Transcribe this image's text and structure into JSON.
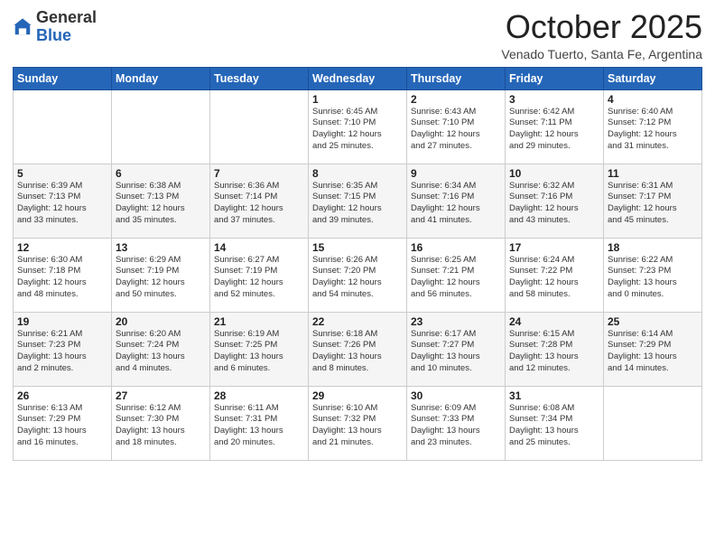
{
  "header": {
    "logo_general": "General",
    "logo_blue": "Blue",
    "month_title": "October 2025",
    "location": "Venado Tuerto, Santa Fe, Argentina"
  },
  "weekdays": [
    "Sunday",
    "Monday",
    "Tuesday",
    "Wednesday",
    "Thursday",
    "Friday",
    "Saturday"
  ],
  "weeks": [
    [
      {
        "day": "",
        "info": ""
      },
      {
        "day": "",
        "info": ""
      },
      {
        "day": "",
        "info": ""
      },
      {
        "day": "1",
        "info": "Sunrise: 6:45 AM\nSunset: 7:10 PM\nDaylight: 12 hours\nand 25 minutes."
      },
      {
        "day": "2",
        "info": "Sunrise: 6:43 AM\nSunset: 7:10 PM\nDaylight: 12 hours\nand 27 minutes."
      },
      {
        "day": "3",
        "info": "Sunrise: 6:42 AM\nSunset: 7:11 PM\nDaylight: 12 hours\nand 29 minutes."
      },
      {
        "day": "4",
        "info": "Sunrise: 6:40 AM\nSunset: 7:12 PM\nDaylight: 12 hours\nand 31 minutes."
      }
    ],
    [
      {
        "day": "5",
        "info": "Sunrise: 6:39 AM\nSunset: 7:13 PM\nDaylight: 12 hours\nand 33 minutes."
      },
      {
        "day": "6",
        "info": "Sunrise: 6:38 AM\nSunset: 7:13 PM\nDaylight: 12 hours\nand 35 minutes."
      },
      {
        "day": "7",
        "info": "Sunrise: 6:36 AM\nSunset: 7:14 PM\nDaylight: 12 hours\nand 37 minutes."
      },
      {
        "day": "8",
        "info": "Sunrise: 6:35 AM\nSunset: 7:15 PM\nDaylight: 12 hours\nand 39 minutes."
      },
      {
        "day": "9",
        "info": "Sunrise: 6:34 AM\nSunset: 7:16 PM\nDaylight: 12 hours\nand 41 minutes."
      },
      {
        "day": "10",
        "info": "Sunrise: 6:32 AM\nSunset: 7:16 PM\nDaylight: 12 hours\nand 43 minutes."
      },
      {
        "day": "11",
        "info": "Sunrise: 6:31 AM\nSunset: 7:17 PM\nDaylight: 12 hours\nand 45 minutes."
      }
    ],
    [
      {
        "day": "12",
        "info": "Sunrise: 6:30 AM\nSunset: 7:18 PM\nDaylight: 12 hours\nand 48 minutes."
      },
      {
        "day": "13",
        "info": "Sunrise: 6:29 AM\nSunset: 7:19 PM\nDaylight: 12 hours\nand 50 minutes."
      },
      {
        "day": "14",
        "info": "Sunrise: 6:27 AM\nSunset: 7:19 PM\nDaylight: 12 hours\nand 52 minutes."
      },
      {
        "day": "15",
        "info": "Sunrise: 6:26 AM\nSunset: 7:20 PM\nDaylight: 12 hours\nand 54 minutes."
      },
      {
        "day": "16",
        "info": "Sunrise: 6:25 AM\nSunset: 7:21 PM\nDaylight: 12 hours\nand 56 minutes."
      },
      {
        "day": "17",
        "info": "Sunrise: 6:24 AM\nSunset: 7:22 PM\nDaylight: 12 hours\nand 58 minutes."
      },
      {
        "day": "18",
        "info": "Sunrise: 6:22 AM\nSunset: 7:23 PM\nDaylight: 13 hours\nand 0 minutes."
      }
    ],
    [
      {
        "day": "19",
        "info": "Sunrise: 6:21 AM\nSunset: 7:23 PM\nDaylight: 13 hours\nand 2 minutes."
      },
      {
        "day": "20",
        "info": "Sunrise: 6:20 AM\nSunset: 7:24 PM\nDaylight: 13 hours\nand 4 minutes."
      },
      {
        "day": "21",
        "info": "Sunrise: 6:19 AM\nSunset: 7:25 PM\nDaylight: 13 hours\nand 6 minutes."
      },
      {
        "day": "22",
        "info": "Sunrise: 6:18 AM\nSunset: 7:26 PM\nDaylight: 13 hours\nand 8 minutes."
      },
      {
        "day": "23",
        "info": "Sunrise: 6:17 AM\nSunset: 7:27 PM\nDaylight: 13 hours\nand 10 minutes."
      },
      {
        "day": "24",
        "info": "Sunrise: 6:15 AM\nSunset: 7:28 PM\nDaylight: 13 hours\nand 12 minutes."
      },
      {
        "day": "25",
        "info": "Sunrise: 6:14 AM\nSunset: 7:29 PM\nDaylight: 13 hours\nand 14 minutes."
      }
    ],
    [
      {
        "day": "26",
        "info": "Sunrise: 6:13 AM\nSunset: 7:29 PM\nDaylight: 13 hours\nand 16 minutes."
      },
      {
        "day": "27",
        "info": "Sunrise: 6:12 AM\nSunset: 7:30 PM\nDaylight: 13 hours\nand 18 minutes."
      },
      {
        "day": "28",
        "info": "Sunrise: 6:11 AM\nSunset: 7:31 PM\nDaylight: 13 hours\nand 20 minutes."
      },
      {
        "day": "29",
        "info": "Sunrise: 6:10 AM\nSunset: 7:32 PM\nDaylight: 13 hours\nand 21 minutes."
      },
      {
        "day": "30",
        "info": "Sunrise: 6:09 AM\nSunset: 7:33 PM\nDaylight: 13 hours\nand 23 minutes."
      },
      {
        "day": "31",
        "info": "Sunrise: 6:08 AM\nSunset: 7:34 PM\nDaylight: 13 hours\nand 25 minutes."
      },
      {
        "day": "",
        "info": ""
      }
    ]
  ]
}
